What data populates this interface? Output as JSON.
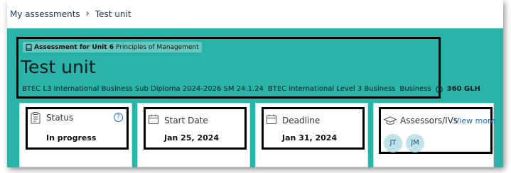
{
  "breadcrumb": {
    "parent": "My assessments",
    "current": "Test unit"
  },
  "header": {
    "assessment_label": "Assessment for Unit 6",
    "unit_name": "Principles of Management",
    "title": "Test unit",
    "qualification": "BTEC L3 International Business Sub Diploma 2024-2026 SM 24.1.24",
    "level": "BTEC International Level 3 Business",
    "subject": "Business",
    "glh": "360 GLH"
  },
  "cards": {
    "status": {
      "label": "Status",
      "value": "In progress"
    },
    "start_date": {
      "label": "Start Date",
      "value": "Jan 25, 2024"
    },
    "deadline": {
      "label": "Deadline",
      "value": "Jan 31, 2024"
    },
    "assessors": {
      "label": "Assessors/IVs",
      "view_more": "View more",
      "avatars": [
        "JT",
        "JM"
      ]
    }
  },
  "colors": {
    "header_bg": "#2ab3a8",
    "link": "#1a6fd6",
    "avatar_bg": "#bfe3ea"
  }
}
